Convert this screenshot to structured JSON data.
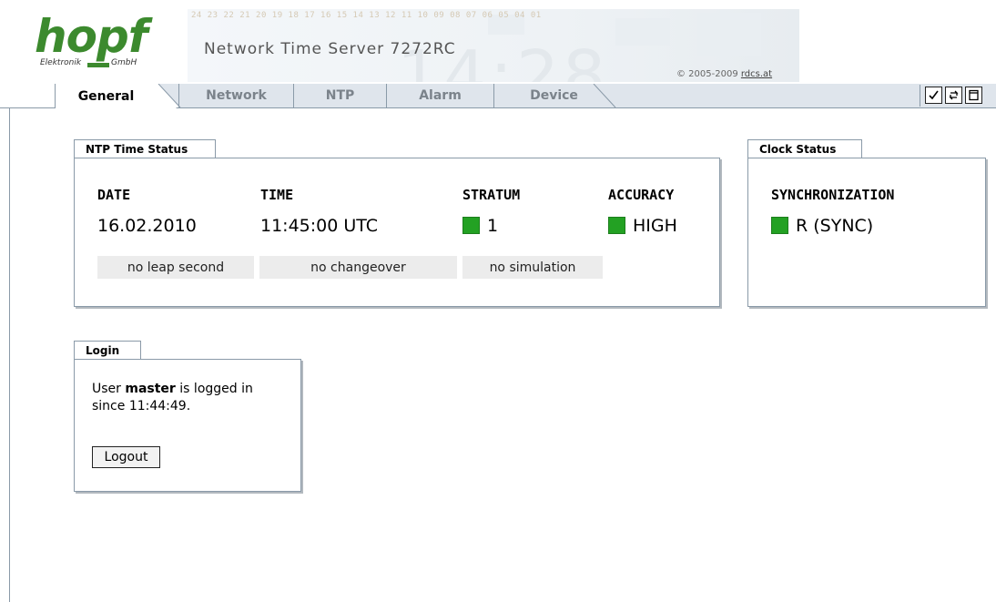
{
  "header": {
    "logo": {
      "word": "hopf",
      "sub_left": "Elektronik",
      "sub_right": "GmbH"
    },
    "hour_scale": "24 23 22 21 20 19 18 17 16 15 14 13 12 11 10 09 08 07 06 05 04 01",
    "product_title": "Network Time Server 7272RC",
    "copyright_prefix": "© 2005-2009 ",
    "copyright_link": "rdcs.at"
  },
  "tabs": [
    {
      "label": "General",
      "active": true
    },
    {
      "label": "Network",
      "active": false
    },
    {
      "label": "NTP",
      "active": false
    },
    {
      "label": "Alarm",
      "active": false
    },
    {
      "label": "Device",
      "active": false
    }
  ],
  "toolbar": {
    "apply_icon": "checkmark-icon",
    "refresh_icon": "refresh-icon",
    "window_icon": "window-icon"
  },
  "ntp_status": {
    "title": "NTP Time Status",
    "date_label": "DATE",
    "date_value": "16.02.2010",
    "time_label": "TIME",
    "time_value": "11:45:00 UTC",
    "stratum_label": "STRATUM",
    "stratum_value": "1",
    "accuracy_label": "ACCURACY",
    "accuracy_value": "HIGH",
    "leap": "no leap second",
    "changeover": "no changeover",
    "simulation": "no simulation",
    "status_color": "#23a123"
  },
  "clock_status": {
    "title": "Clock Status",
    "sync_label": "SYNCHRONIZATION",
    "sync_value": "R (SYNC)"
  },
  "login": {
    "title": "Login",
    "text_prefix": "User ",
    "user": "master",
    "text_mid": " is logged in",
    "text_since": "since 11:44:49.",
    "logout_label": "Logout"
  }
}
